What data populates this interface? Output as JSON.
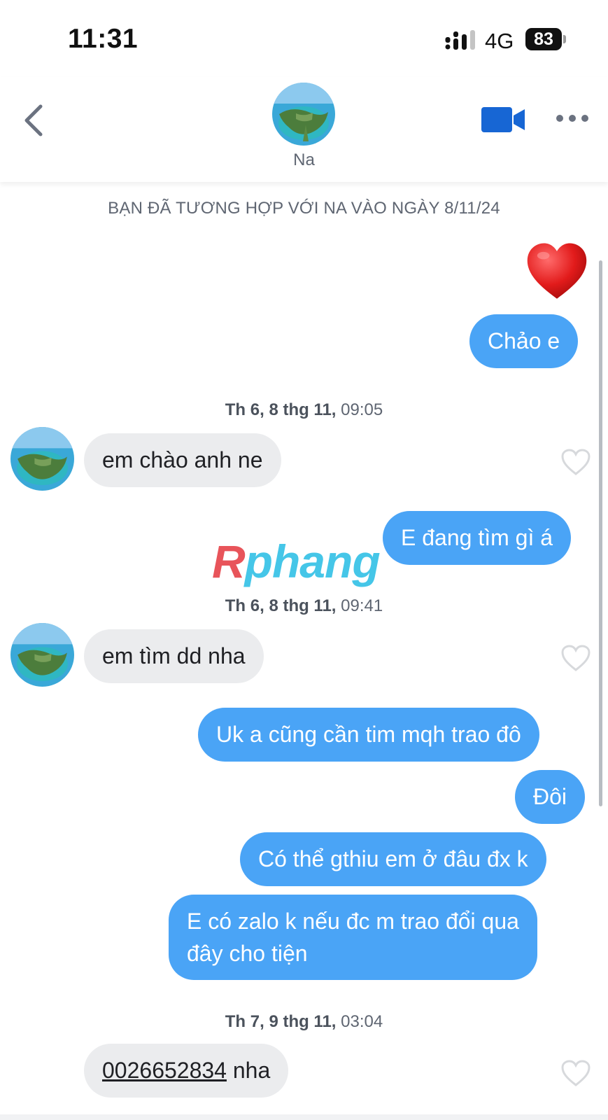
{
  "status_bar": {
    "time": "11:31",
    "network": "4G",
    "battery": "83"
  },
  "header": {
    "contact_name": "Na",
    "back_icon": "chevron-left-icon",
    "video_icon": "video-camera-icon",
    "more_icon": "more-horizontal-icon"
  },
  "match_banner": "BẠN ĐÃ TƯƠNG HỢP VỚI NA VÀO NGÀY 8/11/24",
  "reaction": {
    "icon": "red-heart-emoji"
  },
  "messages": {
    "m1": {
      "text": "Chảo e"
    },
    "ts1": {
      "day": "Th 6, 8 thg 11,",
      "time": "09:05"
    },
    "m2": {
      "text": "em chào anh ne"
    },
    "m3": {
      "text": "E đang tìm gì á"
    },
    "ts2": {
      "day": "Th 6, 8 thg 11,",
      "time": "09:41"
    },
    "m4": {
      "text": "em tìm dd nha"
    },
    "m5": {
      "text": "Uk a cũng cần tim mqh trao đô"
    },
    "m6": {
      "text": "Đôi"
    },
    "m7": {
      "text": "Có thể gthiu em ở đâu đx k"
    },
    "m8": {
      "line1": "E có zalo k nếu đc m trao đổi qua",
      "line2": "đây cho tiện"
    },
    "ts3": {
      "day": "Th 7, 9 thg 11,",
      "time": "03:04"
    },
    "m9": {
      "link": "0026652834",
      "text": " nha"
    }
  },
  "watermark": {
    "first": "R",
    "rest": "phang"
  },
  "colors": {
    "outgoing_bubble": "#4aa4f6",
    "incoming_bubble": "#ebecee",
    "accent": "#1766d4"
  }
}
